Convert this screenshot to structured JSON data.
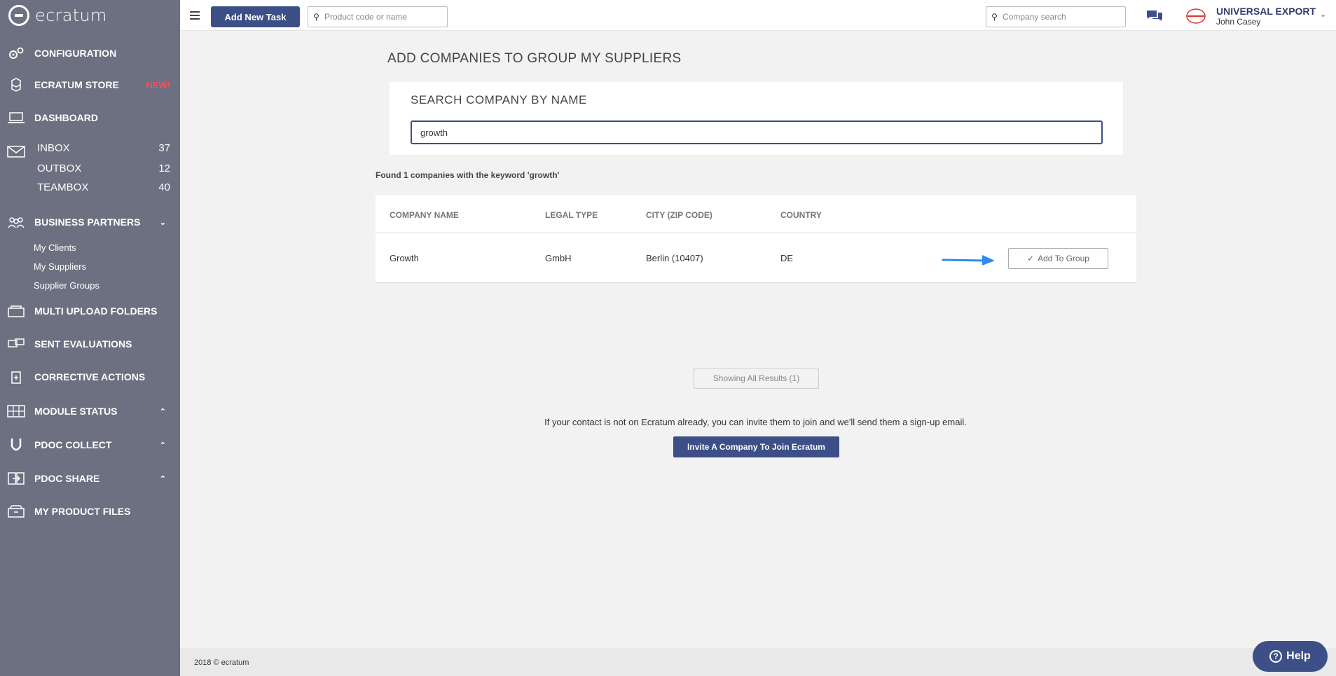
{
  "brand": {
    "name": "ecratum"
  },
  "sidebar": {
    "configuration": "CONFIGURATION",
    "store": "ECRATUM STORE",
    "store_badge": "NEW!",
    "dashboard": "DASHBOARD",
    "boxes": [
      {
        "label": "INBOX",
        "count": "37"
      },
      {
        "label": "OUTBOX",
        "count": "12"
      },
      {
        "label": "TEAMBOX",
        "count": "40"
      }
    ],
    "business_partners": "BUSINESS PARTNERS",
    "partners_sub": [
      "My Clients",
      "My Suppliers",
      "Supplier Groups"
    ],
    "multi_upload": "MULTI UPLOAD FOLDERS",
    "sent_evaluations": "SENT EVALUATIONS",
    "corrective_actions": "CORRECTIVE ACTIONS",
    "module_status": "MODULE STATUS",
    "pdoc_collect": "PDOC COLLECT",
    "pdoc_share": "PDOC SHARE",
    "product_files": "MY PRODUCT FILES"
  },
  "topbar": {
    "add_task": "Add New Task",
    "product_search_placeholder": "Product code or name",
    "company_search_placeholder": "Company search",
    "company_name": "UNIVERSAL EXPORT",
    "user_name": "John Casey"
  },
  "main": {
    "title": "ADD COMPANIES TO GROUP MY SUPPLIERS",
    "search_heading": "SEARCH COMPANY BY NAME",
    "search_value": "growth",
    "result_summary": "Found 1 companies with the keyword 'growth'",
    "table": {
      "headers": [
        "COMPANY NAME",
        "LEGAL TYPE",
        "CITY (ZIP CODE)",
        "COUNTRY"
      ],
      "rows": [
        {
          "company": "Growth",
          "legal_type": "GmbH",
          "city": "Berlin (10407)",
          "country": "DE",
          "action": "Add To Group"
        }
      ]
    },
    "showing_results": "Showing All Results (1)",
    "invite_text": "If your contact is not on Ecratum already, you can invite them to join and we'll send them a sign-up email.",
    "invite_button": "Invite A Company To Join Ecratum"
  },
  "footer": {
    "copyright": "2018 © ecratum"
  },
  "help": {
    "label": "Help"
  },
  "colors": {
    "sidebar": "#6d7080",
    "primary": "#3d4f87",
    "badge": "#ff4b5c",
    "arrow": "#2d8cf0"
  }
}
